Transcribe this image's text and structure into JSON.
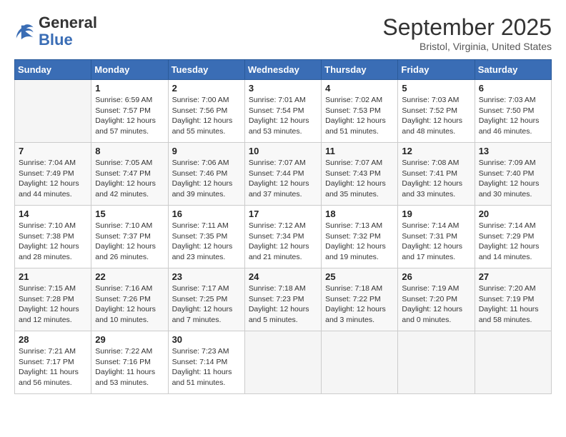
{
  "header": {
    "logo_general": "General",
    "logo_blue": "Blue",
    "month": "September 2025",
    "location": "Bristol, Virginia, United States"
  },
  "weekdays": [
    "Sunday",
    "Monday",
    "Tuesday",
    "Wednesday",
    "Thursday",
    "Friday",
    "Saturday"
  ],
  "weeks": [
    [
      {
        "day": "",
        "sunrise": "",
        "sunset": "",
        "daylight": ""
      },
      {
        "day": "1",
        "sunrise": "Sunrise: 6:59 AM",
        "sunset": "Sunset: 7:57 PM",
        "daylight": "Daylight: 12 hours and 57 minutes."
      },
      {
        "day": "2",
        "sunrise": "Sunrise: 7:00 AM",
        "sunset": "Sunset: 7:56 PM",
        "daylight": "Daylight: 12 hours and 55 minutes."
      },
      {
        "day": "3",
        "sunrise": "Sunrise: 7:01 AM",
        "sunset": "Sunset: 7:54 PM",
        "daylight": "Daylight: 12 hours and 53 minutes."
      },
      {
        "day": "4",
        "sunrise": "Sunrise: 7:02 AM",
        "sunset": "Sunset: 7:53 PM",
        "daylight": "Daylight: 12 hours and 51 minutes."
      },
      {
        "day": "5",
        "sunrise": "Sunrise: 7:03 AM",
        "sunset": "Sunset: 7:52 PM",
        "daylight": "Daylight: 12 hours and 48 minutes."
      },
      {
        "day": "6",
        "sunrise": "Sunrise: 7:03 AM",
        "sunset": "Sunset: 7:50 PM",
        "daylight": "Daylight: 12 hours and 46 minutes."
      }
    ],
    [
      {
        "day": "7",
        "sunrise": "Sunrise: 7:04 AM",
        "sunset": "Sunset: 7:49 PM",
        "daylight": "Daylight: 12 hours and 44 minutes."
      },
      {
        "day": "8",
        "sunrise": "Sunrise: 7:05 AM",
        "sunset": "Sunset: 7:47 PM",
        "daylight": "Daylight: 12 hours and 42 minutes."
      },
      {
        "day": "9",
        "sunrise": "Sunrise: 7:06 AM",
        "sunset": "Sunset: 7:46 PM",
        "daylight": "Daylight: 12 hours and 39 minutes."
      },
      {
        "day": "10",
        "sunrise": "Sunrise: 7:07 AM",
        "sunset": "Sunset: 7:44 PM",
        "daylight": "Daylight: 12 hours and 37 minutes."
      },
      {
        "day": "11",
        "sunrise": "Sunrise: 7:07 AM",
        "sunset": "Sunset: 7:43 PM",
        "daylight": "Daylight: 12 hours and 35 minutes."
      },
      {
        "day": "12",
        "sunrise": "Sunrise: 7:08 AM",
        "sunset": "Sunset: 7:41 PM",
        "daylight": "Daylight: 12 hours and 33 minutes."
      },
      {
        "day": "13",
        "sunrise": "Sunrise: 7:09 AM",
        "sunset": "Sunset: 7:40 PM",
        "daylight": "Daylight: 12 hours and 30 minutes."
      }
    ],
    [
      {
        "day": "14",
        "sunrise": "Sunrise: 7:10 AM",
        "sunset": "Sunset: 7:38 PM",
        "daylight": "Daylight: 12 hours and 28 minutes."
      },
      {
        "day": "15",
        "sunrise": "Sunrise: 7:10 AM",
        "sunset": "Sunset: 7:37 PM",
        "daylight": "Daylight: 12 hours and 26 minutes."
      },
      {
        "day": "16",
        "sunrise": "Sunrise: 7:11 AM",
        "sunset": "Sunset: 7:35 PM",
        "daylight": "Daylight: 12 hours and 23 minutes."
      },
      {
        "day": "17",
        "sunrise": "Sunrise: 7:12 AM",
        "sunset": "Sunset: 7:34 PM",
        "daylight": "Daylight: 12 hours and 21 minutes."
      },
      {
        "day": "18",
        "sunrise": "Sunrise: 7:13 AM",
        "sunset": "Sunset: 7:32 PM",
        "daylight": "Daylight: 12 hours and 19 minutes."
      },
      {
        "day": "19",
        "sunrise": "Sunrise: 7:14 AM",
        "sunset": "Sunset: 7:31 PM",
        "daylight": "Daylight: 12 hours and 17 minutes."
      },
      {
        "day": "20",
        "sunrise": "Sunrise: 7:14 AM",
        "sunset": "Sunset: 7:29 PM",
        "daylight": "Daylight: 12 hours and 14 minutes."
      }
    ],
    [
      {
        "day": "21",
        "sunrise": "Sunrise: 7:15 AM",
        "sunset": "Sunset: 7:28 PM",
        "daylight": "Daylight: 12 hours and 12 minutes."
      },
      {
        "day": "22",
        "sunrise": "Sunrise: 7:16 AM",
        "sunset": "Sunset: 7:26 PM",
        "daylight": "Daylight: 12 hours and 10 minutes."
      },
      {
        "day": "23",
        "sunrise": "Sunrise: 7:17 AM",
        "sunset": "Sunset: 7:25 PM",
        "daylight": "Daylight: 12 hours and 7 minutes."
      },
      {
        "day": "24",
        "sunrise": "Sunrise: 7:18 AM",
        "sunset": "Sunset: 7:23 PM",
        "daylight": "Daylight: 12 hours and 5 minutes."
      },
      {
        "day": "25",
        "sunrise": "Sunrise: 7:18 AM",
        "sunset": "Sunset: 7:22 PM",
        "daylight": "Daylight: 12 hours and 3 minutes."
      },
      {
        "day": "26",
        "sunrise": "Sunrise: 7:19 AM",
        "sunset": "Sunset: 7:20 PM",
        "daylight": "Daylight: 12 hours and 0 minutes."
      },
      {
        "day": "27",
        "sunrise": "Sunrise: 7:20 AM",
        "sunset": "Sunset: 7:19 PM",
        "daylight": "Daylight: 11 hours and 58 minutes."
      }
    ],
    [
      {
        "day": "28",
        "sunrise": "Sunrise: 7:21 AM",
        "sunset": "Sunset: 7:17 PM",
        "daylight": "Daylight: 11 hours and 56 minutes."
      },
      {
        "day": "29",
        "sunrise": "Sunrise: 7:22 AM",
        "sunset": "Sunset: 7:16 PM",
        "daylight": "Daylight: 11 hours and 53 minutes."
      },
      {
        "day": "30",
        "sunrise": "Sunrise: 7:23 AM",
        "sunset": "Sunset: 7:14 PM",
        "daylight": "Daylight: 11 hours and 51 minutes."
      },
      {
        "day": "",
        "sunrise": "",
        "sunset": "",
        "daylight": ""
      },
      {
        "day": "",
        "sunrise": "",
        "sunset": "",
        "daylight": ""
      },
      {
        "day": "",
        "sunrise": "",
        "sunset": "",
        "daylight": ""
      },
      {
        "day": "",
        "sunrise": "",
        "sunset": "",
        "daylight": ""
      }
    ]
  ]
}
